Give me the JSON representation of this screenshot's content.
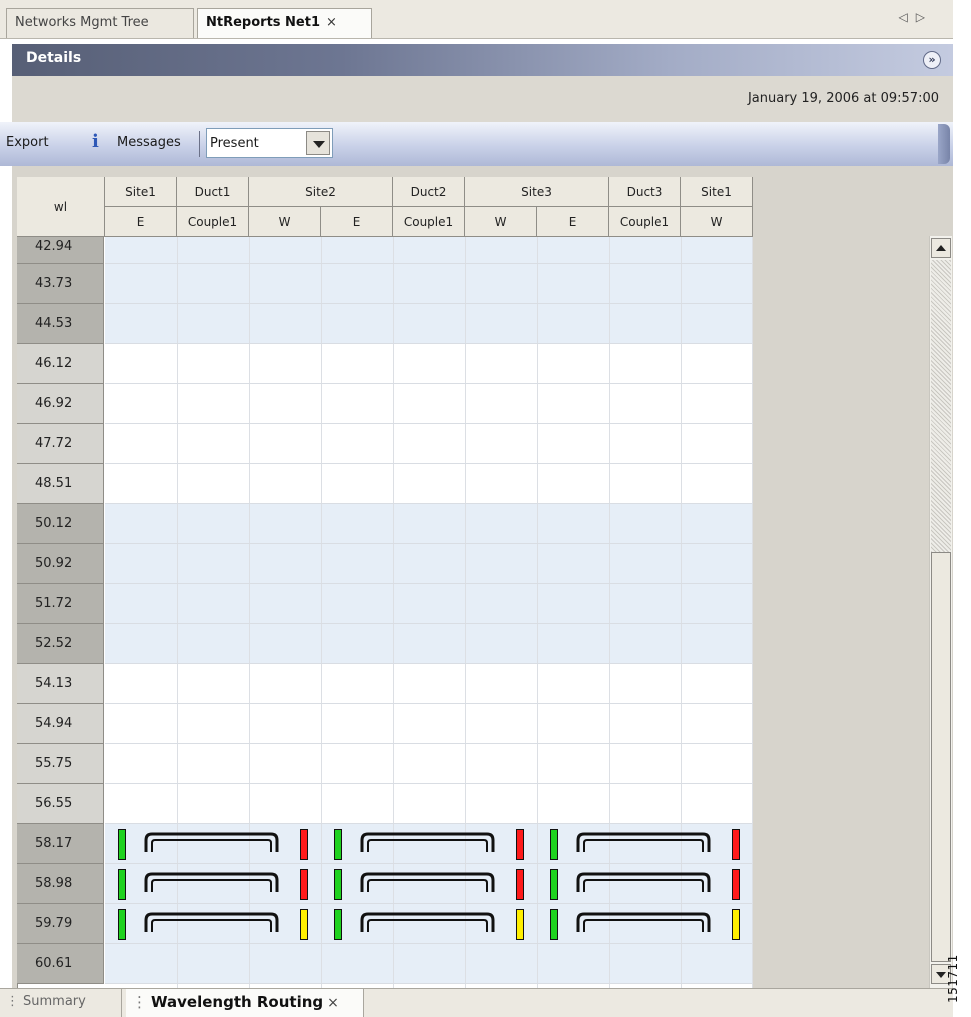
{
  "top_tabs": [
    {
      "label": "Networks Mgmt Tree",
      "active": false
    },
    {
      "label": "NtReports Net1",
      "active": true,
      "close": "×"
    }
  ],
  "tab_nav": {
    "prev": "◁",
    "next": "▷"
  },
  "details": {
    "title": "Details",
    "collapse_icon": "double-chevron-down-icon"
  },
  "timestamp": "January 19, 2006 at 09:57:00",
  "toolbar": {
    "export_label": "Export",
    "info_glyph": "i",
    "messages_label": "Messages",
    "present_value": "Present"
  },
  "table": {
    "corner_label": "wl",
    "header_row1": [
      "Site1",
      "Duct1",
      "Site2",
      "Duct2",
      "Site3",
      "Duct3",
      "Site1"
    ],
    "header_row2": [
      "E",
      "Couple1",
      "W",
      "E",
      "Couple1",
      "W",
      "E",
      "Couple1",
      "W"
    ],
    "wavelengths": [
      "42.94",
      "43.73",
      "44.53",
      "46.12",
      "46.92",
      "47.72",
      "48.51",
      "50.12",
      "50.92",
      "51.72",
      "52.52",
      "54.13",
      "54.94",
      "55.75",
      "56.55",
      "58.17",
      "58.98",
      "59.79",
      "60.61"
    ],
    "routes": [
      {
        "wl": "58.17",
        "statuses": [
          "green",
          "red",
          "green",
          "red",
          "green",
          "red"
        ]
      },
      {
        "wl": "58.98",
        "statuses": [
          "green",
          "red",
          "green",
          "red",
          "green",
          "red"
        ]
      },
      {
        "wl": "59.79",
        "statuses": [
          "green",
          "yellow",
          "green",
          "yellow",
          "green",
          "yellow"
        ]
      }
    ],
    "status_colors": {
      "green": "#1fd21f",
      "red": "#ff1a1a",
      "yellow": "#ffef00"
    }
  },
  "bottom_tabs": [
    {
      "label": "Summary",
      "active": false
    },
    {
      "label": "Wavelength Routing",
      "active": true,
      "close": "×"
    }
  ],
  "figure_id": "151711"
}
